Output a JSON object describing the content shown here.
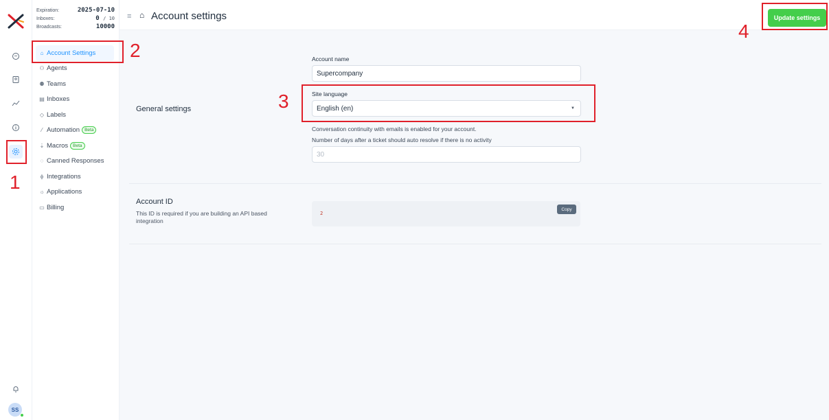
{
  "header": {
    "title": "Account settings",
    "update_button": "Update settings"
  },
  "plan": {
    "expiration_label": "Expiration:",
    "expiration_value": "2025-07-10",
    "inboxes_label": "Inboxes:",
    "inboxes_used": "0",
    "inboxes_total": "/ 10",
    "broadcasts_label": "Broadcasts:",
    "broadcasts_value": "10000"
  },
  "sidebar": {
    "items": [
      {
        "label": "Account Settings",
        "icon": "store-icon"
      },
      {
        "label": "Agents",
        "icon": "agents-icon"
      },
      {
        "label": "Teams",
        "icon": "teams-icon"
      },
      {
        "label": "Inboxes",
        "icon": "inbox-icon"
      },
      {
        "label": "Labels",
        "icon": "tag-icon"
      },
      {
        "label": "Automation",
        "icon": "automation-icon",
        "badge": "Beta"
      },
      {
        "label": "Macros",
        "icon": "macros-icon",
        "badge": "Beta"
      },
      {
        "label": "Canned Responses",
        "icon": "chat-icon"
      },
      {
        "label": "Integrations",
        "icon": "plug-icon"
      },
      {
        "label": "Applications",
        "icon": "apps-icon"
      },
      {
        "label": "Billing",
        "icon": "billing-icon"
      }
    ]
  },
  "general": {
    "section_title": "General settings",
    "account_name_label": "Account name",
    "account_name_value": "Supercompany",
    "language_label": "Site language",
    "language_value": "English (en)",
    "continuity_note": "Conversation continuity with emails is enabled for your account.",
    "auto_resolve_label": "Number of days after a ticket should auto resolve if there is no activity",
    "auto_resolve_placeholder": "30"
  },
  "account_id": {
    "title": "Account ID",
    "description": "This ID is required if you are building an API based integration",
    "value": "2",
    "copy_label": "Copy"
  },
  "user": {
    "initials": "SS"
  },
  "annotations": [
    "1",
    "2",
    "3",
    "4"
  ],
  "colors": {
    "accent": "#1f93ff",
    "success": "#44ce4b",
    "annotation": "#e0202a"
  }
}
